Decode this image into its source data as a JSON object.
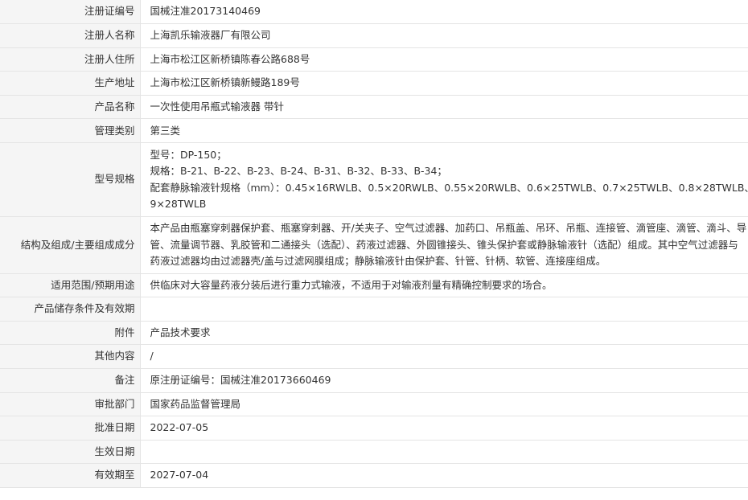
{
  "rows": [
    {
      "label": "注册证编号",
      "value": "国械注准20173140469"
    },
    {
      "label": "注册人名称",
      "value": "上海凯乐输液器厂有限公司"
    },
    {
      "label": "注册人住所",
      "value": "上海市松江区新桥镇陈春公路688号"
    },
    {
      "label": "生产地址",
      "value": "上海市松江区新桥镇新鳗路189号"
    },
    {
      "label": "产品名称",
      "value": "一次性使用吊瓶式输液器 带针"
    },
    {
      "label": "管理类别",
      "value": "第三类"
    },
    {
      "label": "型号规格",
      "lines": [
        "型号：DP-150；",
        "规格：B-21、B-22、B-23、B-24、B-31、B-32、B-33、B-34；",
        "配套静脉输液针规格（mm）：0.45×16RWLB、0.5×20RWLB、0.55×20RWLB、0.6×25TWLB、0.7×25TWLB、0.8×28TWLB、0.",
        "9×28TWLB"
      ]
    },
    {
      "label": "结构及组成/主要组成成分",
      "value": "本产品由瓶塞穿刺器保护套、瓶塞穿刺器、开/关夹子、空气过滤器、加药口、吊瓶盖、吊环、吊瓶、连接管、滴管座、滴管、滴斗、导管、流量调节器、乳胶管和二通接头（选配）、药液过滤器、外圆锥接头、锥头保护套或静脉输液针（选配）组成。其中空气过滤器与药液过滤器均由过滤器壳/盖与过滤网膜组成；静脉输液针由保护套、针管、针柄、软管、连接座组成。"
    },
    {
      "label": "适用范围/预期用途",
      "value": "供临床对大容量药液分装后进行重力式输液，不适用于对输液剂量有精确控制要求的场合。"
    },
    {
      "label": "产品储存条件及有效期",
      "value": ""
    },
    {
      "label": "附件",
      "value": "产品技术要求"
    },
    {
      "label": "其他内容",
      "value": "/"
    },
    {
      "label": "备注",
      "value": "原注册证编号：国械注准20173660469"
    },
    {
      "label": "审批部门",
      "value": "国家药品监督管理局"
    },
    {
      "label": "批准日期",
      "value": "2022-07-05"
    },
    {
      "label": "生效日期",
      "value": ""
    },
    {
      "label": "有效期至",
      "value": "2027-07-04"
    }
  ]
}
